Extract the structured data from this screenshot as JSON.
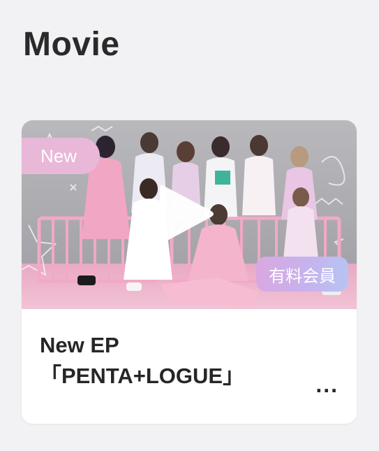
{
  "section": {
    "title": "Movie"
  },
  "card": {
    "badge_new": "New",
    "badge_paid": "有料会員",
    "title_line1": "New EP",
    "title_line2": "「PENTA+LOGUE」",
    "more": "..."
  },
  "icons": {
    "play": "play-icon",
    "more": "more-dots-icon"
  },
  "colors": {
    "badge_new": "#e9b7d7",
    "badge_paid_gradient": [
      "#d9a8e0",
      "#b6c4f3"
    ],
    "title_text": "#2a2a2a"
  }
}
